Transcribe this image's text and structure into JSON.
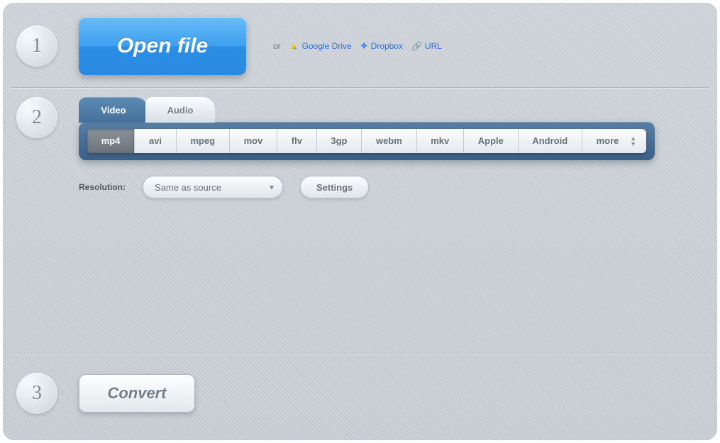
{
  "steps": {
    "one": "1",
    "two": "2",
    "three": "3"
  },
  "open_file_label": "Open file",
  "source": {
    "or": "or",
    "gdrive": "Google Drive",
    "dropbox": "Dropbox",
    "url": "URL"
  },
  "tabs": {
    "video": "Video",
    "audio": "Audio"
  },
  "formats": [
    "mp4",
    "avi",
    "mpeg",
    "mov",
    "flv",
    "3gp",
    "webm",
    "mkv",
    "Apple",
    "Android",
    "more"
  ],
  "selected_format_index": 0,
  "resolution_label": "Resolution:",
  "resolution_value": "Same as source",
  "settings_label": "Settings",
  "convert_label": "Convert"
}
